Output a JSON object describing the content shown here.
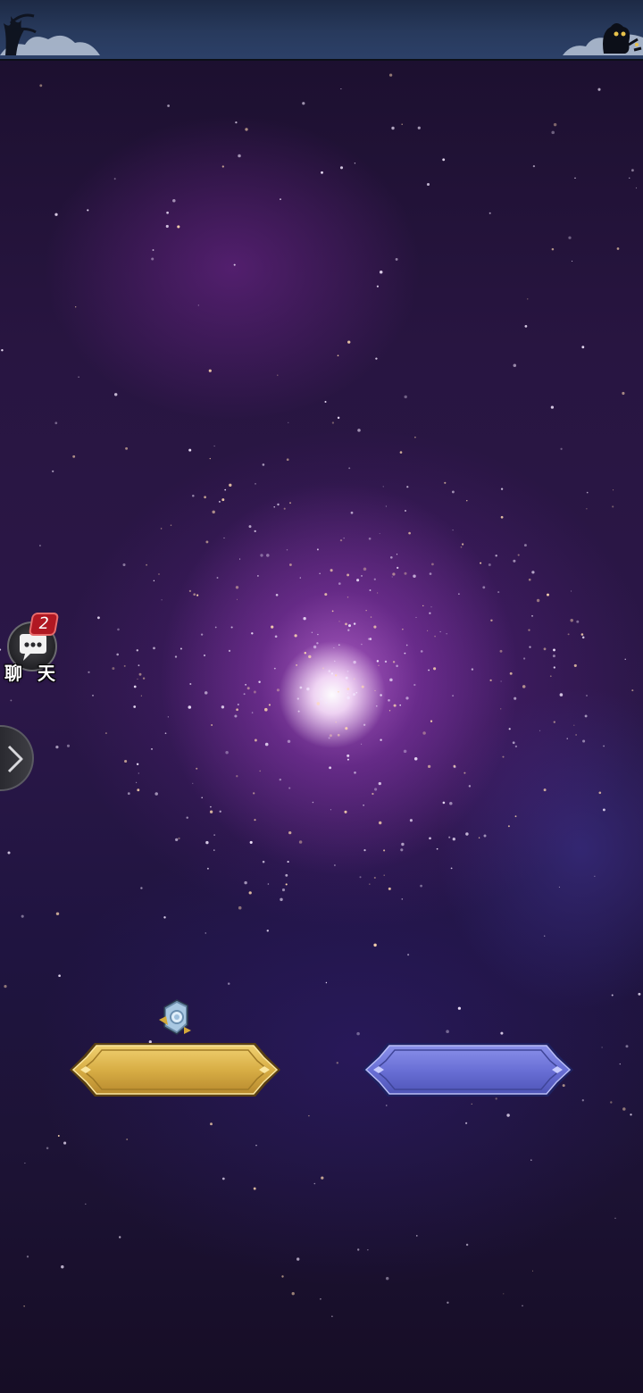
{
  "chat": {
    "label": "聊 天",
    "unread_count": "2"
  },
  "buttons": {
    "left_color": "#d8b048",
    "right_color": "#6d72d8"
  },
  "icons": {
    "chat": "chat-bubble-icon",
    "expand": "chevron-right-icon",
    "rune": "rune-gem-icon"
  }
}
